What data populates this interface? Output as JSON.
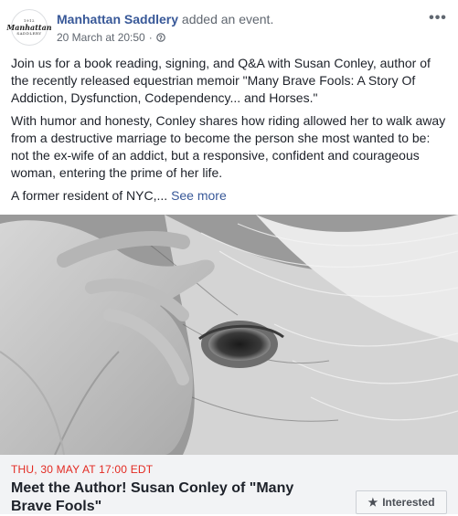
{
  "post": {
    "page_name": "Manhattan Saddlery",
    "action": " added an event.",
    "timestamp": "20 March at 20:50",
    "dot": "·",
    "more_icon": "•••",
    "avatar": {
      "line1": "1912",
      "line2": "Manhattan",
      "line3": "SADDLERY"
    },
    "paragraphs": [
      "Join us for a book reading, signing, and Q&A with Susan Conley, author of the recently released equestrian memoir \"Many Brave Fools: A Story Of Addiction, Dysfunction, Codependency... and Horses.\"",
      "With humor and honesty, Conley shares how riding allowed her to walk away from a destructive marriage to become the person she most wanted to be: not the ex-wife of an addict, but a responsive, confident and courageous woman, entering the prime of her life."
    ],
    "truncated_text": "A former resident of NYC,... ",
    "see_more": "See more"
  },
  "event": {
    "date": "THU, 30 MAY AT 17:00 EDT",
    "title": "Meet the Author! Susan Conley of \"Many Brave Fools\"",
    "interested_label": "Interested",
    "star_icon": "★"
  },
  "colors": {
    "link": "#385898",
    "date_red": "#e32a22",
    "event_bg": "#f2f3f5"
  }
}
